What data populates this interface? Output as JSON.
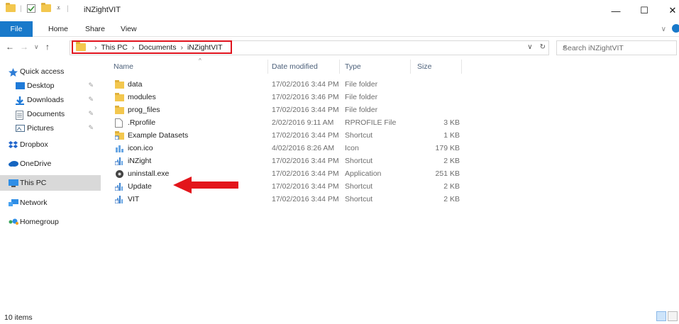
{
  "window": {
    "title": "iNZightVIT",
    "controls": {
      "minimize": "—",
      "maximize": "☐",
      "close": "✕"
    }
  },
  "ribbon": {
    "tabs": [
      "File",
      "Home",
      "Share",
      "View"
    ]
  },
  "address": {
    "crumbs": [
      "This PC",
      "Documents",
      "iNZightVIT"
    ],
    "search_placeholder": "Search iNZightVIT"
  },
  "nav": {
    "quick_access": "Quick access",
    "items": [
      {
        "label": "Desktop",
        "pinned": true,
        "icon": "desktop-icon"
      },
      {
        "label": "Downloads",
        "pinned": true,
        "icon": "downloads-icon"
      },
      {
        "label": "Documents",
        "pinned": true,
        "icon": "documents-icon"
      },
      {
        "label": "Pictures",
        "pinned": true,
        "icon": "pictures-icon"
      }
    ],
    "roots": [
      "Dropbox",
      "OneDrive",
      "This PC",
      "Network",
      "Homegroup"
    ],
    "selected": "This PC"
  },
  "columns": {
    "name": "Name",
    "date": "Date modified",
    "type": "Type",
    "size": "Size"
  },
  "files": [
    {
      "name": "data",
      "date": "17/02/2016 3:44 PM",
      "type": "File folder",
      "size": "",
      "icon": "folder-icon"
    },
    {
      "name": "modules",
      "date": "17/02/2016 3:46 PM",
      "type": "File folder",
      "size": "",
      "icon": "folder-icon"
    },
    {
      "name": "prog_files",
      "date": "17/02/2016 3:44 PM",
      "type": "File folder",
      "size": "",
      "icon": "folder-icon"
    },
    {
      "name": ".Rprofile",
      "date": "2/02/2016 9:11 AM",
      "type": "RPROFILE File",
      "size": "3 KB",
      "icon": "file-icon"
    },
    {
      "name": "Example Datasets",
      "date": "17/02/2016 3:44 PM",
      "type": "Shortcut",
      "size": "1 KB",
      "icon": "folder-shortcut-icon"
    },
    {
      "name": "icon.ico",
      "date": "4/02/2016 8:26 AM",
      "type": "Icon",
      "size": "179 KB",
      "icon": "ico-file-icon"
    },
    {
      "name": "iNZight",
      "date": "17/02/2016 3:44 PM",
      "type": "Shortcut",
      "size": "2 KB",
      "icon": "app-shortcut-icon"
    },
    {
      "name": "uninstall.exe",
      "date": "17/02/2016 3:44 PM",
      "type": "Application",
      "size": "251 KB",
      "icon": "exe-icon"
    },
    {
      "name": "Update",
      "date": "17/02/2016 3:44 PM",
      "type": "Shortcut",
      "size": "2 KB",
      "icon": "app-shortcut-icon"
    },
    {
      "name": "VIT",
      "date": "17/02/2016 3:44 PM",
      "type": "Shortcut",
      "size": "2 KB",
      "icon": "app-shortcut-icon"
    }
  ],
  "status": {
    "items": "10 items"
  },
  "colors": {
    "accent": "#1979ca",
    "highlight": "#e0141e",
    "arrow": "#e3151b"
  }
}
